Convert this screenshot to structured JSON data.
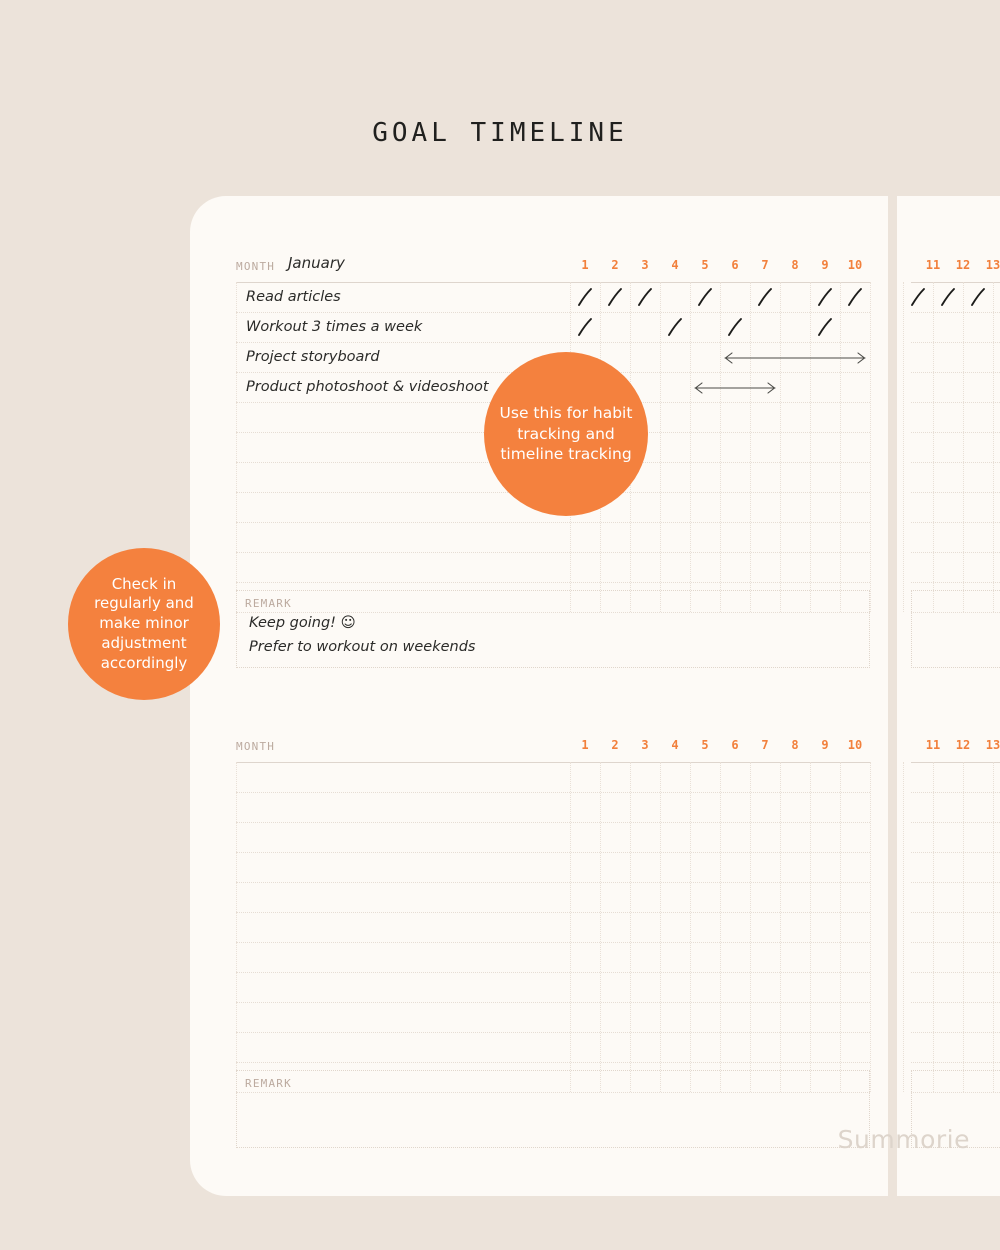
{
  "title": "GOAL TIMELINE",
  "watermark": "Summorie",
  "colors": {
    "background": "#ece3da",
    "paper": "#fdfaf6",
    "accent": "#f4813e",
    "day_number": "#f2803c",
    "label_muted": "#bcaa9f",
    "ink": "#2b2b29",
    "grid": "#e6ddd4"
  },
  "bubbles": [
    {
      "id": "habit",
      "text": "Use this for habit tracking and timeline tracking"
    },
    {
      "id": "checkin",
      "text": "Check in regularly and make minor adjustment accordingly"
    }
  ],
  "tables": [
    {
      "id": "upper",
      "month_label": "MONTH",
      "month_value": "January",
      "day_numbers_left": [
        "1",
        "2",
        "3",
        "4",
        "5",
        "6",
        "7",
        "8",
        "9",
        "10"
      ],
      "day_numbers_right": [
        "11",
        "12",
        "13"
      ],
      "row_count": 11,
      "tasks": [
        {
          "name": "Read articles",
          "row": 0,
          "ticks_left": [
            1,
            2,
            3,
            5,
            7,
            9,
            10
          ],
          "ticks_right": [
            11,
            12,
            13
          ],
          "bar": null
        },
        {
          "name": "Workout 3 times a week",
          "row": 1,
          "ticks_left": [
            1,
            4,
            6,
            9
          ],
          "ticks_right": [],
          "bar": null
        },
        {
          "name": "Project storyboard",
          "row": 2,
          "ticks_left": [],
          "ticks_right": [],
          "bar": {
            "start": 6,
            "end": 10
          }
        },
        {
          "name": "Product photoshoot & videoshoot",
          "row": 3,
          "ticks_left": [],
          "ticks_right": [],
          "bar": {
            "start": 5,
            "end": 7
          }
        }
      ],
      "remark": {
        "label": "REMARK",
        "lines": [
          "Keep going!   ☺",
          "Prefer to workout on weekends"
        ]
      }
    },
    {
      "id": "lower",
      "month_label": "MONTH",
      "month_value": "",
      "day_numbers_left": [
        "1",
        "2",
        "3",
        "4",
        "5",
        "6",
        "7",
        "8",
        "9",
        "10"
      ],
      "day_numbers_right": [
        "11",
        "12",
        "13"
      ],
      "row_count": 11,
      "tasks": [],
      "remark": {
        "label": "REMARK",
        "lines": []
      }
    }
  ]
}
